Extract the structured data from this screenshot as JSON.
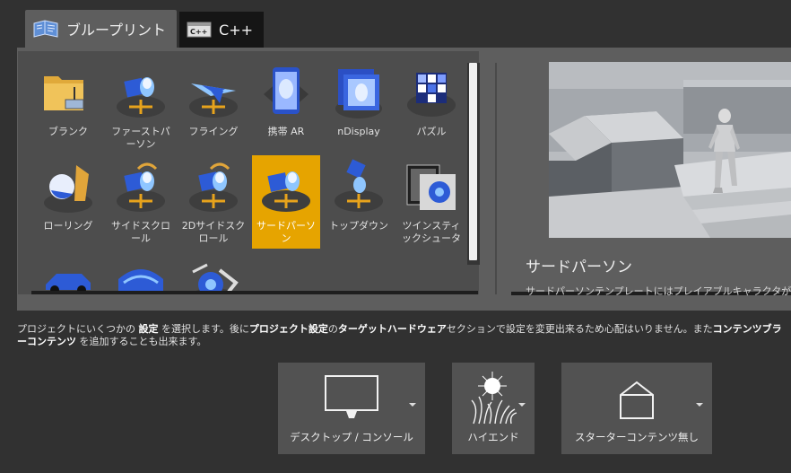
{
  "tabs": [
    {
      "label": "ブループリント",
      "active": true,
      "icon": "blueprint-icon"
    },
    {
      "label": "C++",
      "active": false,
      "icon": "cpp-icon"
    }
  ],
  "templates": [
    {
      "label": "ブランク",
      "icon": "folder-icon"
    },
    {
      "label": "ファーストパーソン",
      "icon": "first-person-icon"
    },
    {
      "label": "フライング",
      "icon": "flying-icon"
    },
    {
      "label": "携帯 AR",
      "icon": "handheld-ar-icon"
    },
    {
      "label": "nDisplay",
      "icon": "ndisplay-icon"
    },
    {
      "label": "パズル",
      "icon": "puzzle-icon"
    },
    {
      "label": "ローリング",
      "icon": "rolling-icon"
    },
    {
      "label": "サイドスクロール",
      "icon": "side-scroller-icon"
    },
    {
      "label": "2Dサイドスクロール",
      "icon": "side-scroller-2d-icon"
    },
    {
      "label": "サードパーソン",
      "icon": "third-person-icon",
      "selected": true
    },
    {
      "label": "トップダウン",
      "icon": "top-down-icon"
    },
    {
      "label": "ツインスティックシュータ",
      "icon": "twin-stick-icon"
    },
    {
      "label": "",
      "icon": "vehicle-icon"
    },
    {
      "label": "",
      "icon": "vr-icon"
    },
    {
      "label": "",
      "icon": "vehicle-advanced-icon"
    }
  ],
  "preview": {
    "title": "サードパーソン",
    "description": "サードパーソンテンプレートにはプレイアブルキャラクタが"
  },
  "info_parts": [
    {
      "t": "プロジェクトにいくつかの ",
      "b": false
    },
    {
      "t": "設定",
      "b": true
    },
    {
      "t": " を選択します。後に",
      "b": false
    },
    {
      "t": "プロジェクト設定",
      "b": true
    },
    {
      "t": "の",
      "b": false
    },
    {
      "t": "ターゲットハードウェア",
      "b": true
    },
    {
      "t": "セクションで設定を変更出来るため心配はいりません。また",
      "b": false
    },
    {
      "t": "コンテンツブラ",
      "b": true
    },
    {
      "t": "ーコンテンツ",
      "b": true
    },
    {
      "t": " を追加することも出来ます。",
      "b": false
    }
  ],
  "settings": [
    {
      "label": "デスクトップ / コンソール",
      "icon": "monitor-icon"
    },
    {
      "label": "ハイエンド",
      "icon": "high-quality-icon"
    },
    {
      "label": "スターターコンテンツ無し",
      "icon": "empty-box-icon"
    }
  ],
  "colors": {
    "selected": "#e6a400",
    "panel": "#5e5e5e",
    "background": "#313131"
  }
}
